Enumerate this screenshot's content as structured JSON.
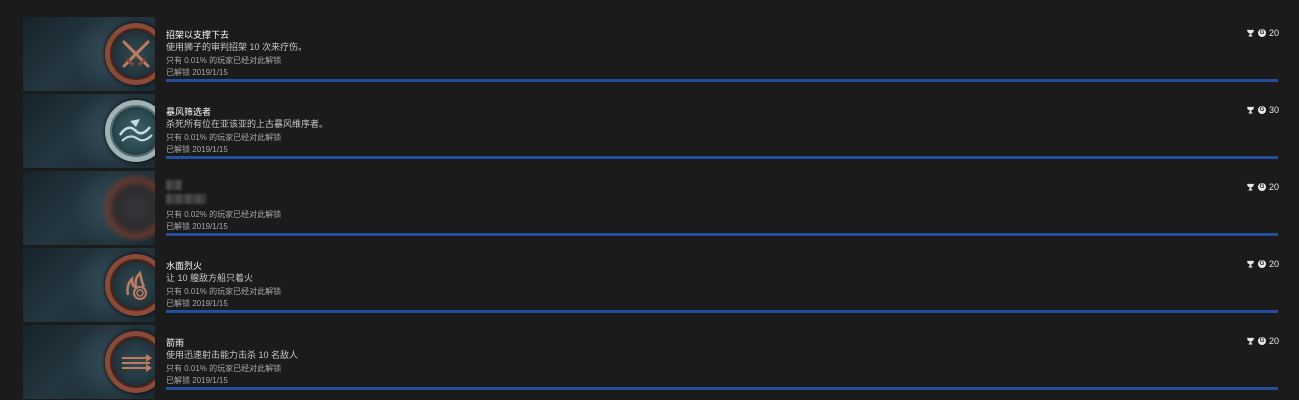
{
  "achievements": [
    {
      "title": "招架以支撑下去",
      "description": "使用狮子的审判招架 10 次来疗伤。",
      "rarity": "只有 0.01% 的玩家已经对此解锁",
      "unlocked": "已解锁 2019/1/15",
      "gamerscore": "20",
      "medal": "bronze",
      "icon": "crossed-swords-icon",
      "progress": 1.0
    },
    {
      "title": "暴风筛选者",
      "description": "杀死所有位在亚该亚的上古暴风维序者。",
      "rarity": "只有 0.01% 的玩家已经对此解锁",
      "unlocked": "已解锁 2019/1/15",
      "gamerscore": "30",
      "medal": "silver",
      "icon": "storm-waves-icon",
      "progress": 1.0
    },
    {
      "title": "",
      "description": "",
      "rarity": "只有 0.02% 的玩家已经对此解锁",
      "unlocked": "已解锁 2019/1/15",
      "gamerscore": "20",
      "medal": "hidden",
      "icon": "hidden-achievement-icon",
      "progress": 1.0
    },
    {
      "title": "水面烈火",
      "description": "让 10 艘敌方船只着火",
      "rarity": "只有 0.01% 的玩家已经对此解锁",
      "unlocked": "已解锁 2019/1/15",
      "gamerscore": "20",
      "medal": "bronze",
      "icon": "burning-ship-icon",
      "progress": 1.0
    },
    {
      "title": "箭雨",
      "description": "使用迅速射击能力击杀 10 名敌人",
      "rarity": "只有 0.01% 的玩家已经对此解锁",
      "unlocked": "已解锁 2019/1/15",
      "gamerscore": "20",
      "medal": "bronze",
      "icon": "arrow-volley-icon",
      "progress": 1.0
    }
  ],
  "colors": {
    "progress_bar": "#254f9e",
    "background": "#1b1b1c",
    "bronze_ring": "#8a4a36",
    "silver_ring": "#9fb3b6"
  }
}
